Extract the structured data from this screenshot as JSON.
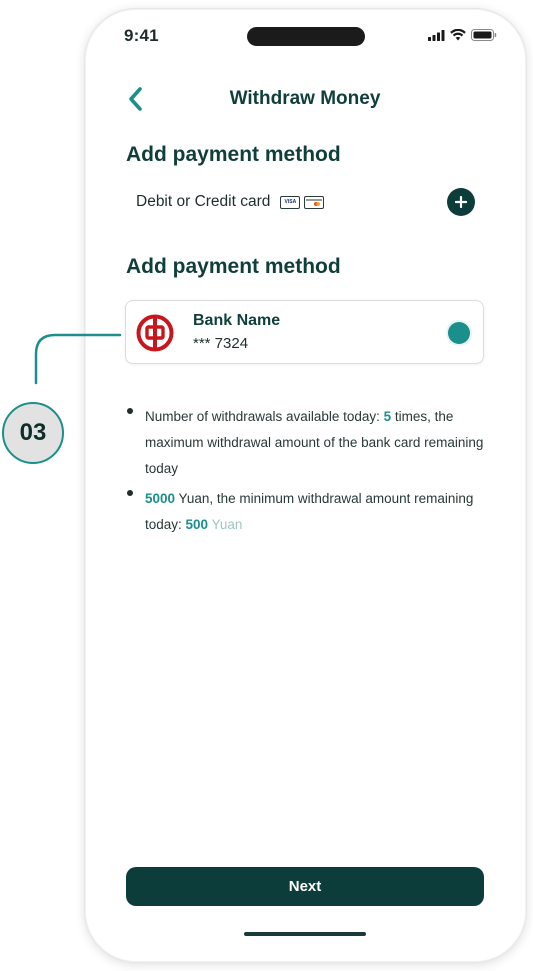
{
  "status_bar": {
    "time": "9:41"
  },
  "header": {
    "title": "Withdraw Money",
    "back_icon": "chevron-left-icon"
  },
  "card_section": {
    "title": "Add payment method",
    "option_label": "Debit or Credit card",
    "logos": [
      "visa-card-icon",
      "mastercard-icon"
    ],
    "visa_text": "VISA",
    "add_icon": "plus-icon"
  },
  "bank_section": {
    "title": "Add payment method",
    "bank_name": "Bank Name",
    "account_masked": "*** 7324",
    "selected": true
  },
  "callout": {
    "step": "03"
  },
  "notes": {
    "n1_before": "Number of withdrawals available today: ",
    "n1_count": "5",
    "n1_after": " times, the maximum withdrawal amount of the bank card remaining today",
    "n2_amount": "5000",
    "n2_middle": " Yuan, the minimum withdrawal amount remaining today: ",
    "n2_min": "500",
    "n2_unit": " Yuan"
  },
  "footer": {
    "next_label": "Next"
  },
  "colors": {
    "primary_dark": "#0d3d3a",
    "accent_teal": "#1b8f8c",
    "bank_red": "#c8161d"
  }
}
